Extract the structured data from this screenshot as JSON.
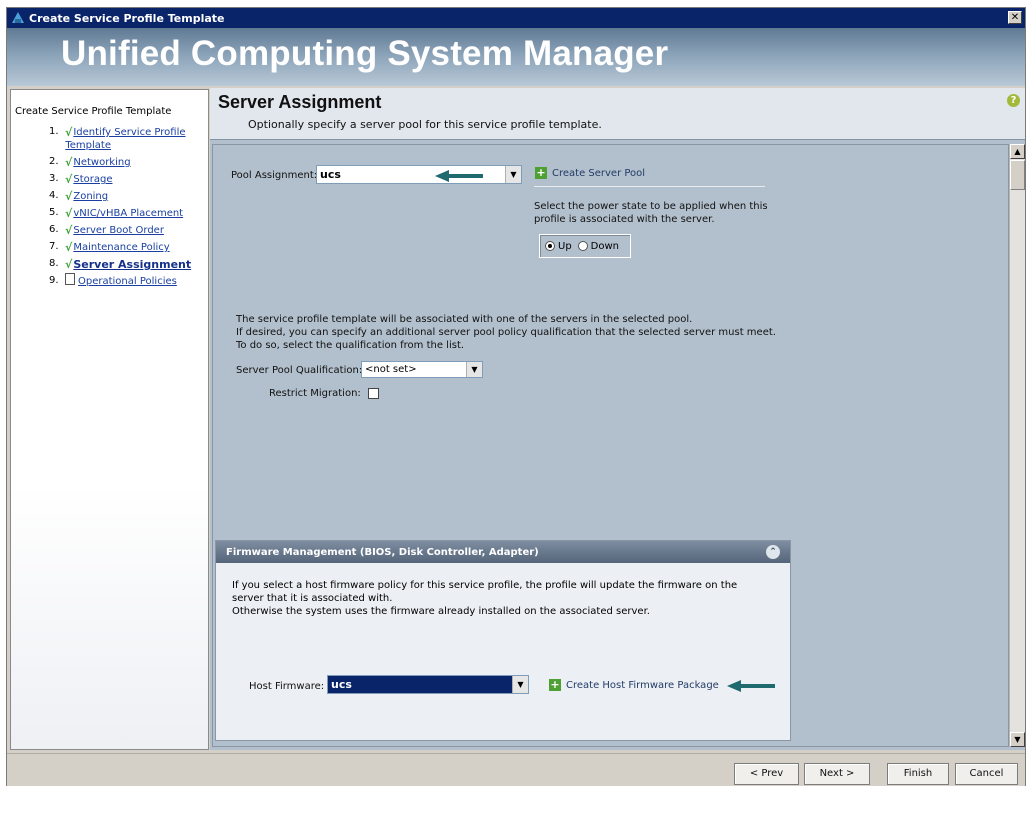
{
  "window": {
    "title": "Create Service Profile Template",
    "banner_title": "Unified Computing System Manager"
  },
  "nav": {
    "title": "Create Service Profile Template",
    "steps": [
      {
        "num": "1.",
        "label": "Identify Service Profile",
        "label2": "Template",
        "done": true
      },
      {
        "num": "2.",
        "label": "Networking",
        "done": true
      },
      {
        "num": "3.",
        "label": "Storage",
        "done": true
      },
      {
        "num": "4.",
        "label": "Zoning",
        "done": true
      },
      {
        "num": "5.",
        "label": "vNIC/vHBA Placement",
        "done": true
      },
      {
        "num": "6.",
        "label": "Server Boot Order",
        "done": true
      },
      {
        "num": "7.",
        "label": "Maintenance Policy",
        "done": true
      },
      {
        "num": "8.",
        "label": "Server Assignment",
        "done": true
      },
      {
        "num": "9.",
        "label": "Operational Policies",
        "done": false
      }
    ]
  },
  "header": {
    "title": "Server Assignment",
    "subtitle": "Optionally specify a server pool for this service profile template.",
    "help": "?"
  },
  "form": {
    "pool_label": "Pool Assignment:",
    "pool_value": "ucs",
    "create_pool": "Create Server Pool",
    "power_text_1": "Select the power state to be applied when this",
    "power_text_2": "profile is associated with the server.",
    "power_up": "Up",
    "power_down": "Down",
    "power_selected": "Up",
    "info_1": "The service profile template will be associated with one of the servers in the selected pool.",
    "info_2": "If desired, you can specify an additional server pool policy qualification that the selected server must meet.",
    "info_3": "To do so, select the qualification from the list.",
    "qual_label": "Server Pool Qualification:",
    "qual_value": "<not set>",
    "restrict_label": "Restrict Migration:"
  },
  "firmware": {
    "title": "Firmware Management (BIOS, Disk Controller, Adapter)",
    "text_1": "If you select a host firmware policy for this service profile, the profile will update the firmware on the",
    "text_2": "server that it is associated with.",
    "text_3": "Otherwise the system uses the firmware already installed on the associated server.",
    "host_label": "Host Firmware:",
    "host_value": "ucs",
    "create_pkg": "Create Host Firmware Package"
  },
  "footer": {
    "prev": "< Prev",
    "next": "Next >",
    "finish": "Finish",
    "cancel": "Cancel"
  },
  "colors": {
    "titlebar": "#0a246a",
    "accent_green": "#3aa335",
    "link": "#1a3fa0"
  }
}
